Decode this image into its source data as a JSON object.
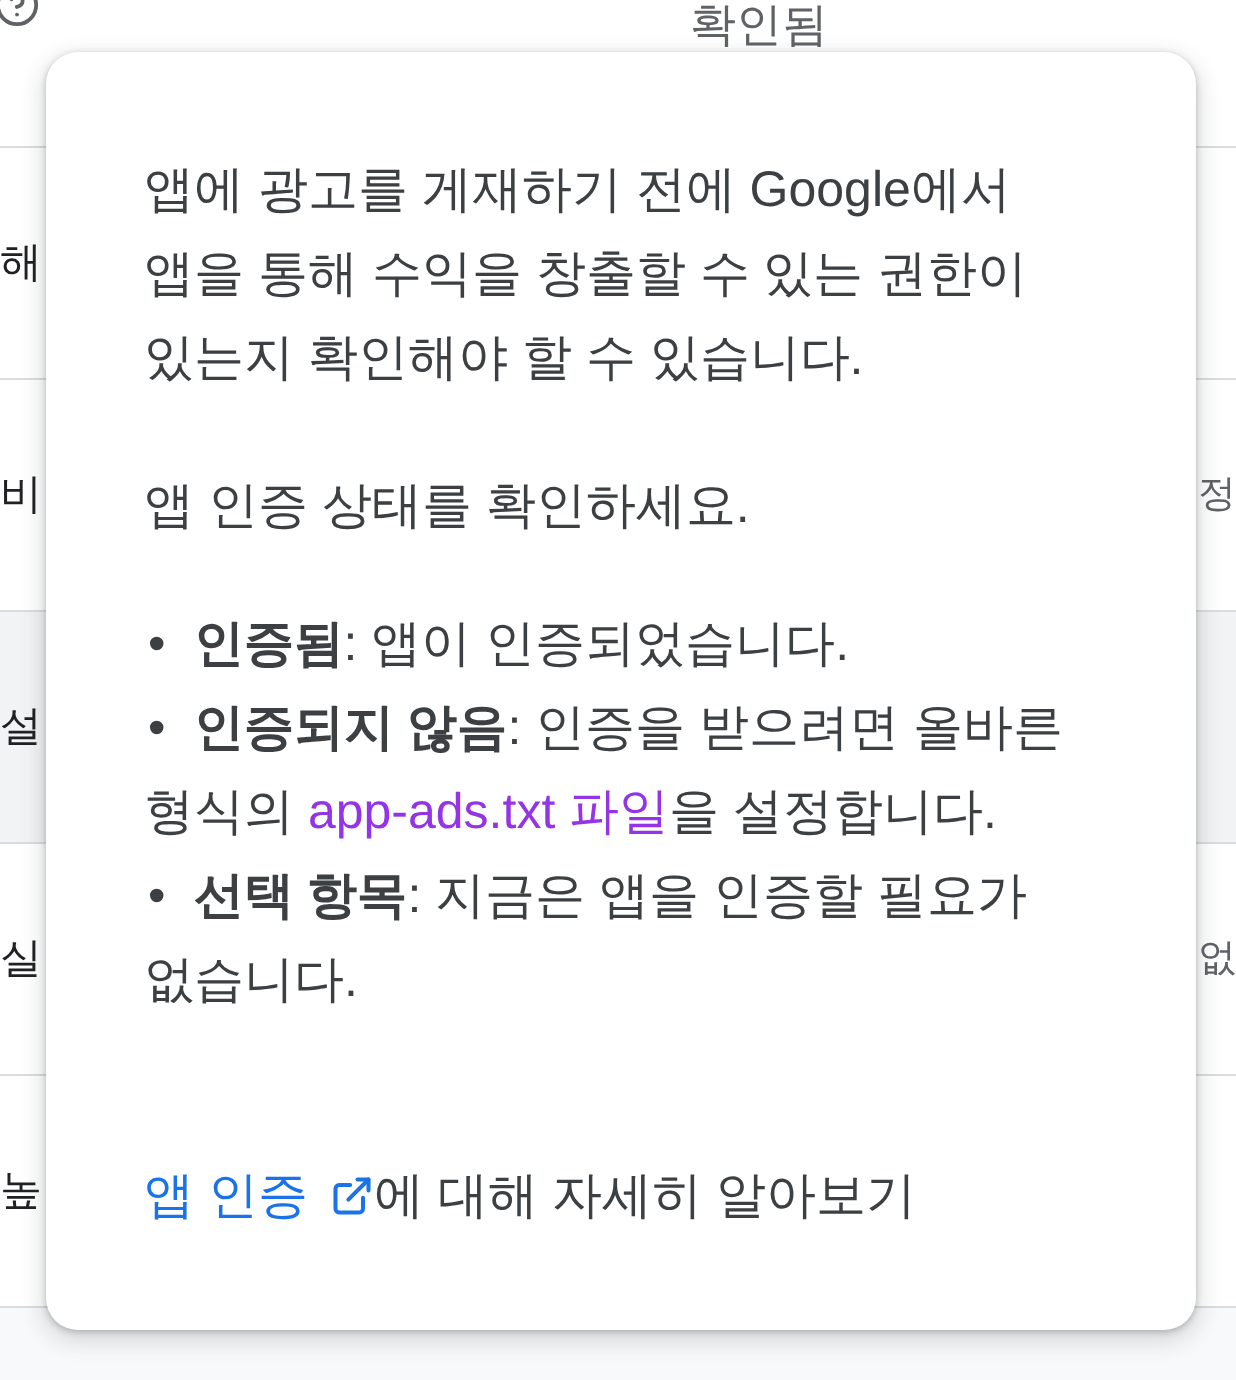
{
  "table": {
    "header": {
      "column_2": "확인됨"
    },
    "rows": [
      {
        "highlighted": false,
        "column_1": "해"
      },
      {
        "highlighted": false,
        "column_1": "비",
        "column_3": "정"
      },
      {
        "highlighted": true,
        "column_1": "설"
      },
      {
        "highlighted": false,
        "column_1": "실",
        "column_3": "없"
      },
      {
        "highlighted": false,
        "column_1": "높"
      }
    ]
  },
  "popover": {
    "paragraphs": [
      "앱에 광고를 게재하기 전에 Google에서 앱을 통해 수익을 창출할 수 있는 권한이 있는지 확인해야 할 수 있습니다.",
      "앱 인증 상태를 확인하세요."
    ],
    "list": [
      {
        "marker": "•",
        "text": "**인증됨**: 앱이 인증되었습니다."
      },
      {
        "marker": "•",
        "text": "**인증되지 않음**: 인증을 받으려면 올바른 형식의 ",
        "link": {
          "text": "app-ads.txt 파일",
          "visited": true
        },
        "text_after": "을 설정합니다."
      },
      {
        "marker": "•",
        "text": "**선택 항목**: 지금은 앱을 인증할 필요가 없습니다."
      }
    ],
    "learn_more": {
      "link": {
        "text": "앱 인증",
        "visited": false,
        "external": true
      },
      "text": "에 대해 자세히 알아보기"
    }
  }
}
